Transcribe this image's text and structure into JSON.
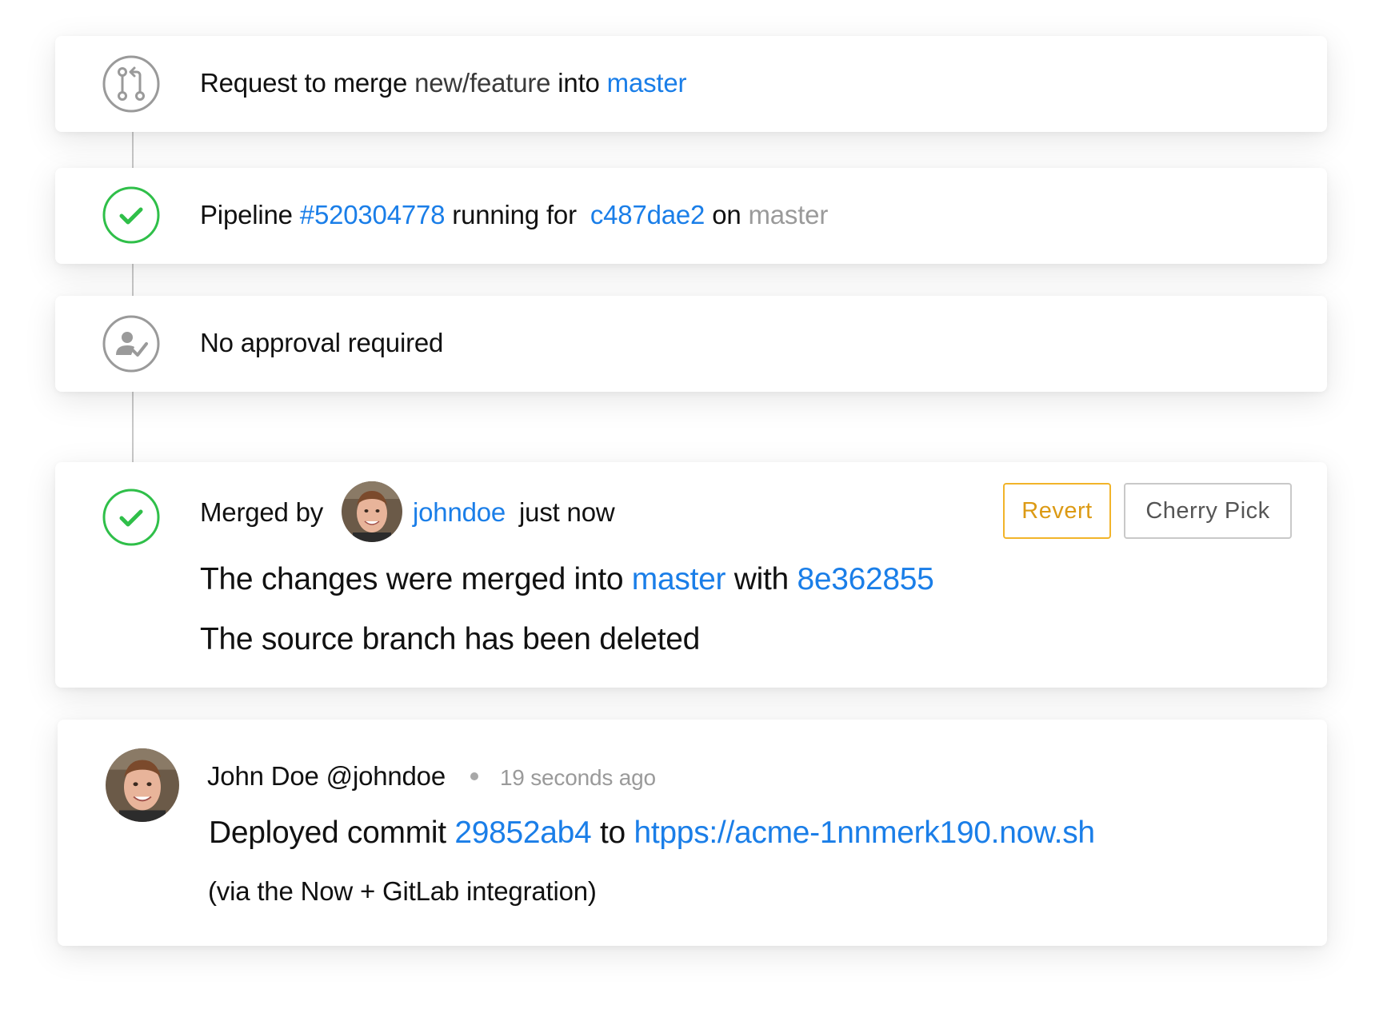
{
  "merge_request": {
    "prefix": "Request to merge",
    "source_branch": "new/feature",
    "into": "into",
    "target_branch": "master"
  },
  "pipeline": {
    "label": "Pipeline",
    "id": "#520304778",
    "running_for": "running for",
    "commit": "c487dae2",
    "on": "on",
    "branch": "master",
    "status_color": "#2fbf49"
  },
  "approval": {
    "text": "No approval required"
  },
  "merged": {
    "by_label": "Merged by",
    "user": "johndoe",
    "when": "just now",
    "revert_label": "Revert",
    "cherry_pick_label": "Cherry Pick",
    "changes_prefix": "The changes were merged into",
    "target_branch": "master",
    "with": "with",
    "merge_commit": "8e362855",
    "source_deleted": "The source branch has been deleted"
  },
  "comment": {
    "author_name": "John Doe",
    "author_handle": "@johndoe",
    "time": "19 seconds ago",
    "deployed_prefix": "Deployed commit",
    "commit": "29852ab4",
    "to": "to",
    "url": "htpps://acme-1nnmerk190.now.sh",
    "note": "(via the Now + GitLab integration)"
  },
  "colors": {
    "link": "#1a7ee8",
    "success": "#2fbf49",
    "revert": "#f2b42a",
    "neutral_icon": "#9a9a9a"
  },
  "icons": {
    "merge_request": "merge-request-icon",
    "pipeline_status": "check-circle-icon",
    "approval": "approval-icon",
    "merged_status": "check-circle-icon"
  }
}
